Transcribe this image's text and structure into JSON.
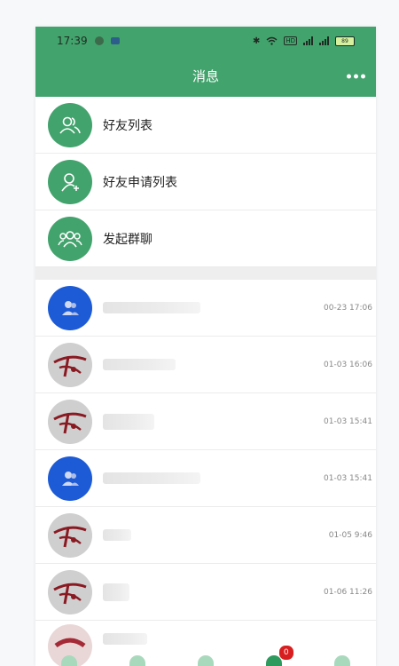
{
  "status_bar": {
    "time": "17:39",
    "hd_label": "HD",
    "battery": "89"
  },
  "header": {
    "title": "消息"
  },
  "menu": [
    {
      "label": "好友列表",
      "icon": "friends-icon"
    },
    {
      "label": "好友申请列表",
      "icon": "add-friend-icon"
    },
    {
      "label": "发起群聊",
      "icon": "group-chat-icon"
    }
  ],
  "chats": [
    {
      "avatar": "blue-group",
      "time": "00-23 17:06"
    },
    {
      "avatar": "logo",
      "time": "01-03 16:06"
    },
    {
      "avatar": "logo",
      "time": "01-03 15:41"
    },
    {
      "avatar": "blue-group",
      "time": "01-03 15:41"
    },
    {
      "avatar": "logo",
      "time": "01-05 9:46"
    },
    {
      "avatar": "logo",
      "time": "01-06 11:26"
    }
  ],
  "tab_bar": {
    "tabs": [
      "home-icon",
      "cube-icon",
      "location-icon",
      "message-icon",
      "profile-icon"
    ],
    "message_badge": "0"
  },
  "colors": {
    "brand_green": "#43a36d",
    "avatar_blue": "#1d5bd6",
    "badge_red": "#d81e1e"
  }
}
